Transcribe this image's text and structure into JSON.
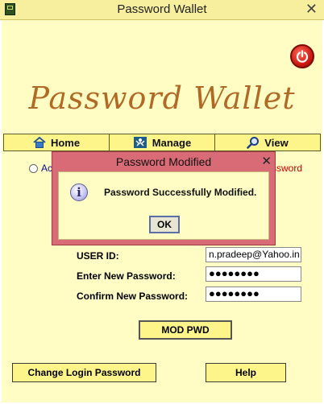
{
  "window": {
    "title": "Password Wallet",
    "close_glyph": "✕"
  },
  "logo": {
    "text": "Password Wallet"
  },
  "nav": {
    "home": "Home",
    "manage": "Manage",
    "view": "View"
  },
  "radio": {
    "left_label_visible": "Ac",
    "right_label_visible": "ssword"
  },
  "form": {
    "user_id_label": "USER ID:",
    "user_id_value": "n.pradeep@Yahoo.in",
    "new_password_label": "Enter New Password:",
    "new_password_value": "●●●●●●●●",
    "confirm_password_label": "Confirm New Password:",
    "confirm_password_value": "●●●●●●●●",
    "mod_pwd_button": "MOD PWD",
    "change_login_button": "Change Login Password",
    "help_button": "Help"
  },
  "dialog": {
    "title": "Password Modified",
    "close_glyph": "✕",
    "info_glyph": "i",
    "message": "Password Successfully Modified.",
    "ok_label": "OK"
  },
  "colors": {
    "accent": "#fdf58a",
    "background": "#fffdc4",
    "dialog_frame": "#d96b76",
    "logo": "#b06a26"
  }
}
